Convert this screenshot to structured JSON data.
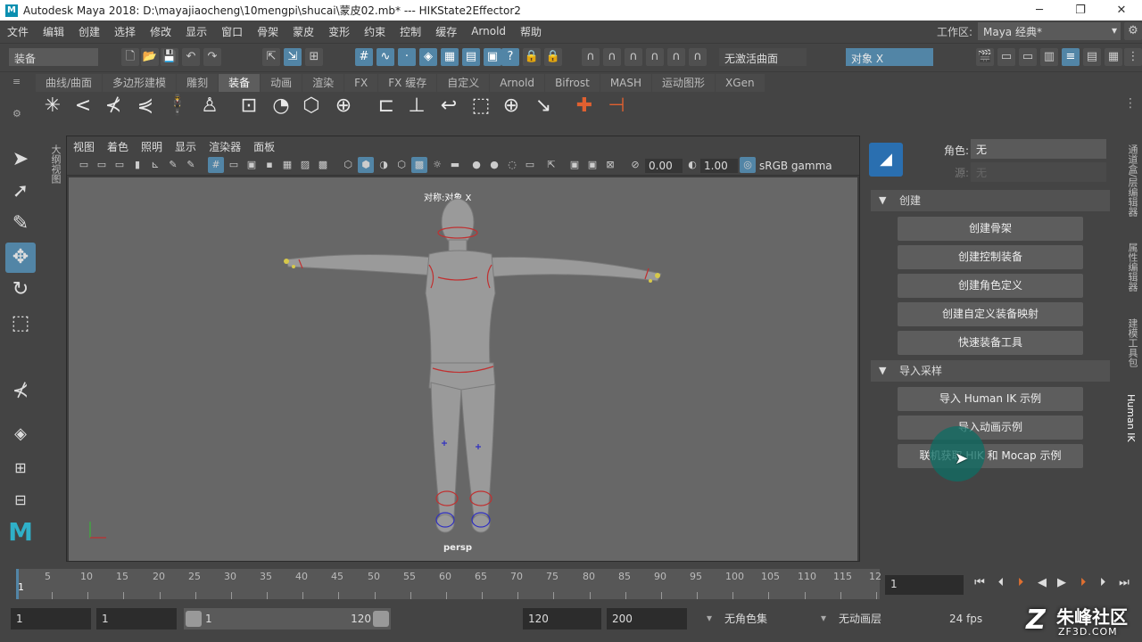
{
  "window": {
    "title": "Autodesk Maya 2018: D:\\mayajiaocheng\\10mengpi\\shucai\\蒙皮02.mb*    ---    HIKState2Effector2",
    "logo": "M"
  },
  "menubar": {
    "items": [
      "文件",
      "编辑",
      "创建",
      "选择",
      "修改",
      "显示",
      "窗口",
      "骨架",
      "蒙皮",
      "变形",
      "约束",
      "控制",
      "缓存",
      "Arnold",
      "帮助"
    ],
    "workspace_label": "工作区:",
    "workspace_value": "Maya 经典*"
  },
  "statusline": {
    "menuset": "装备",
    "live_surface": "无激活曲面",
    "symmetry": "对象 X"
  },
  "shelf": {
    "tabs": [
      "曲线/曲面",
      "多边形建模",
      "雕刻",
      "装备",
      "动画",
      "渲染",
      "FX",
      "FX 缓存",
      "自定义",
      "Arnold",
      "Bifrost",
      "MASH",
      "运动图形",
      "XGen"
    ],
    "active_tab": "装备"
  },
  "viewport": {
    "menu": [
      "视图",
      "着色",
      "照明",
      "显示",
      "渲染器",
      "面板"
    ],
    "exposure": "0.00",
    "gamma": "1.00",
    "colorspace": "sRGB gamma",
    "hud_title": "对称:对象 X",
    "camera_name": "persp"
  },
  "outliner_strip_label": "大纲视图",
  "hik": {
    "character_label": "角色:",
    "character_value": "无",
    "source_label": "源:",
    "source_value": "无",
    "section_create": "创建",
    "create_buttons": [
      "创建骨架",
      "创建控制装备",
      "创建角色定义",
      "创建自定义装备映射",
      "快速装备工具"
    ],
    "section_import": "导入采样",
    "import_buttons": [
      "导入 Human IK 示例",
      "导入动画示例",
      "联机获取 HIK 和 Mocap 示例"
    ]
  },
  "right_tabs": [
    "通道盒/层编辑器",
    "属性编辑器",
    "建模工具包",
    "Human IK"
  ],
  "timeline": {
    "ticks": [
      "5",
      "10",
      "15",
      "20",
      "25",
      "30",
      "35",
      "40",
      "45",
      "50",
      "55",
      "60",
      "65",
      "70",
      "75",
      "80",
      "85",
      "90",
      "95",
      "100",
      "105",
      "110",
      "115",
      "12"
    ],
    "start_marker": "1",
    "current_frame": "1"
  },
  "range": {
    "start": "1",
    "playback_start": "1",
    "slider_start": "1",
    "slider_end": "120",
    "playback_end": "120",
    "end": "200",
    "character_set": "无角色集",
    "anim_layer": "无动画层",
    "fps": "24 fps"
  },
  "watermark": {
    "brand": "朱峰社区",
    "site": "ZF3D.COM"
  },
  "colors": {
    "accent": "#5285a6",
    "teal_cursor": "#0e6e64"
  }
}
